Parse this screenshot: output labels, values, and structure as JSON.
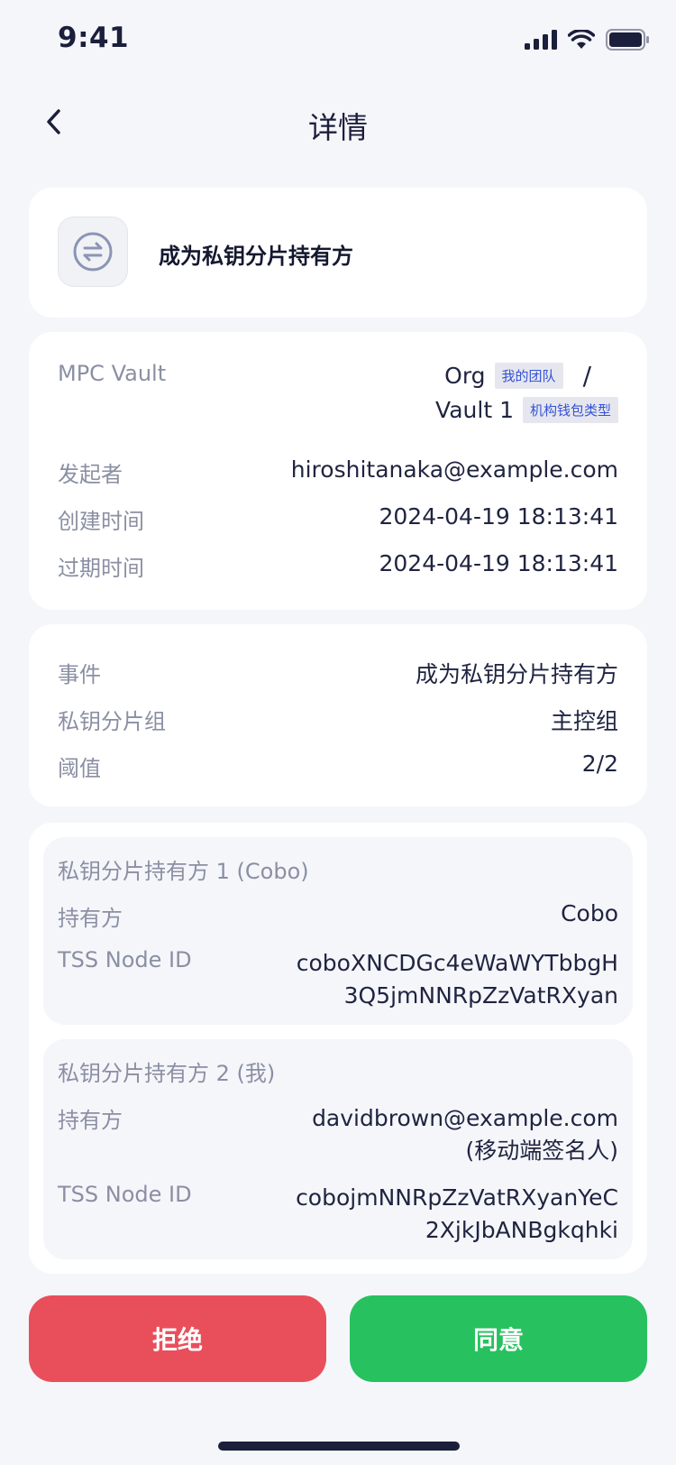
{
  "status_bar": {
    "time": "9:41"
  },
  "nav": {
    "title": "详情"
  },
  "event_card": {
    "icon": "swap-icon",
    "title": "成为私钥分片持有方"
  },
  "info": {
    "vault_label": "MPC Vault",
    "org_name": "Org",
    "org_tag": "我的团队",
    "separator": "/",
    "vault_name": "Vault 1",
    "vault_tag": "机构钱包类型",
    "initiator_label": "发起者",
    "initiator_value": "hiroshitanaka@example.com",
    "created_label": "创建时间",
    "created_value": "2024-04-19 18:13:41",
    "expire_label": "过期时间",
    "expire_value": "2024-04-19 18:13:41"
  },
  "event_info": {
    "event_label": "事件",
    "event_value": "成为私钥分片持有方",
    "group_label": "私钥分片组",
    "group_value": "主控组",
    "threshold_label": "阈值",
    "threshold_value": "2/2"
  },
  "holders": [
    {
      "title": "私钥分片持有方 1 (Cobo)",
      "holder_label": "持有方",
      "holder_value": "Cobo",
      "node_label": "TSS Node ID",
      "node_line1": "coboXNCDGc4eWaWYTbbgH",
      "node_line2": "3Q5jmNNRpZzVatRXyan"
    },
    {
      "title": "私钥分片持有方 2 (我)",
      "holder_label": "持有方",
      "holder_line1": "davidbrown@example.com",
      "holder_line2": "(移动端签名人)",
      "node_label": "TSS Node ID",
      "node_line1": "cobojmNNRpZzVatRXyanYeC",
      "node_line2": "2XjkJbANBgkqhki"
    }
  ],
  "actions": {
    "reject": "拒绝",
    "accept": "同意"
  },
  "colors": {
    "reject": "#e94f5b",
    "accept": "#27c15f",
    "tag_text": "#3552d6"
  }
}
